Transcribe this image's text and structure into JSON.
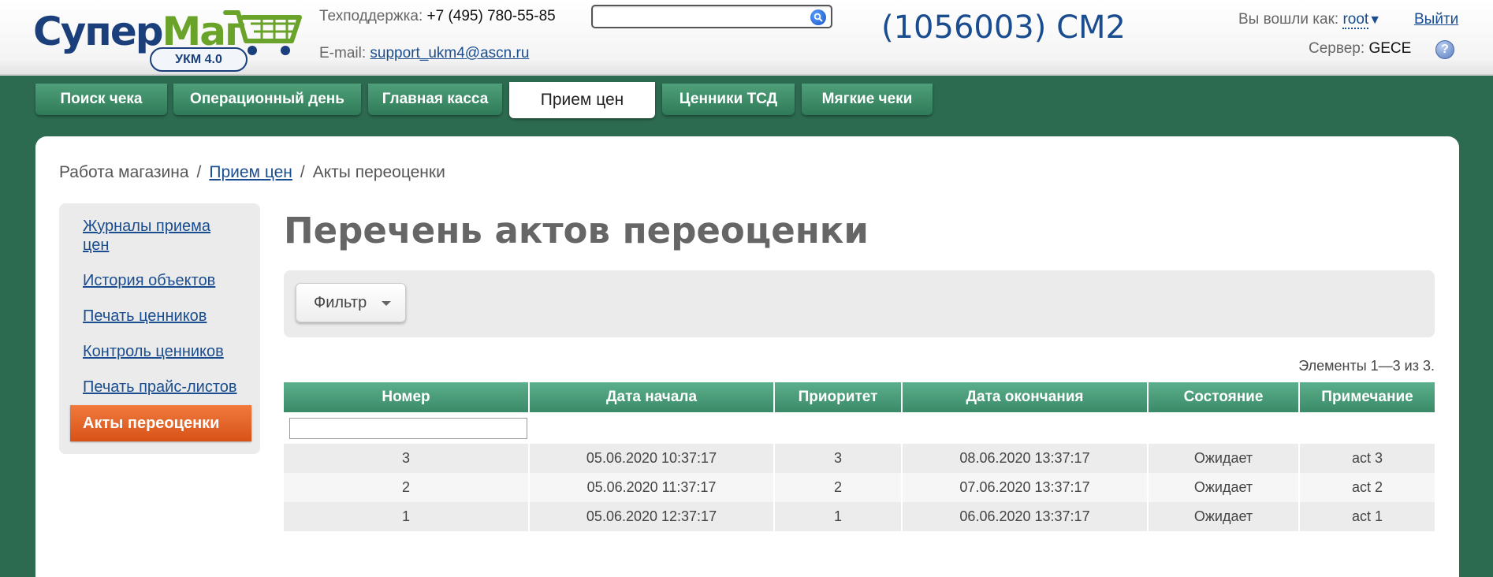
{
  "header": {
    "logo": {
      "part1": "Супер",
      "part2": "Маг",
      "badge": "УКМ 4.0"
    },
    "support": {
      "label": "Техподдержка:",
      "phone": "+7 (495) 780-55-85"
    },
    "email": {
      "label": "E-mail:",
      "address": "support_ukm4@ascn.ru"
    },
    "search": {
      "value": "",
      "placeholder": ""
    },
    "store_title": "(1056003) СМ2",
    "user": {
      "label": "Вы вошли как:",
      "name": "root",
      "caret": "▼"
    },
    "logout": "Выйти",
    "server": {
      "label": "Сервер:",
      "name": "GECE"
    },
    "help": "?"
  },
  "tabs": [
    {
      "label": "Поиск чека",
      "active": false
    },
    {
      "label": "Операционный день",
      "active": false
    },
    {
      "label": "Главная касса",
      "active": false
    },
    {
      "label": "Прием цен",
      "active": true
    },
    {
      "label": "Ценники ТСД",
      "active": false
    },
    {
      "label": "Мягкие чеки",
      "active": false
    }
  ],
  "breadcrumb": {
    "root": "Работа магазина",
    "link": "Прием цен",
    "current": "Акты переоценки",
    "separator": "/"
  },
  "sidebar": {
    "items": [
      {
        "label": "Журналы приема цен",
        "active": false
      },
      {
        "label": "История объектов",
        "active": false
      },
      {
        "label": "Печать ценников",
        "active": false
      },
      {
        "label": "Контроль ценников",
        "active": false
      },
      {
        "label": "Печать прайс-листов",
        "active": false
      },
      {
        "label": "Акты переоценки",
        "active": true
      }
    ]
  },
  "main": {
    "title": "Перечень актов переоценки",
    "filter_label": "Фильтр",
    "count": "Элементы 1—3 из 3.",
    "filter_input": {
      "value": ""
    },
    "table": {
      "columns": [
        "Номер",
        "Дата начала",
        "Приоритет",
        "Дата окончания",
        "Состояние",
        "Примечание"
      ],
      "rows": [
        [
          "3",
          "05.06.2020 10:37:17",
          "3",
          "08.06.2020 13:37:17",
          "Ожидает",
          "act 3"
        ],
        [
          "2",
          "05.06.2020 11:37:17",
          "2",
          "07.06.2020 13:37:17",
          "Ожидает",
          "act 2"
        ],
        [
          "1",
          "05.06.2020 12:37:17",
          "1",
          "06.06.2020 13:37:17",
          "Ожидает",
          "act 1"
        ]
      ]
    }
  },
  "colors": {
    "brand_green": "#2d6b51",
    "tab_green": "#3a8a68",
    "link_blue": "#1a4d8f",
    "active_orange": "#e0601f"
  }
}
